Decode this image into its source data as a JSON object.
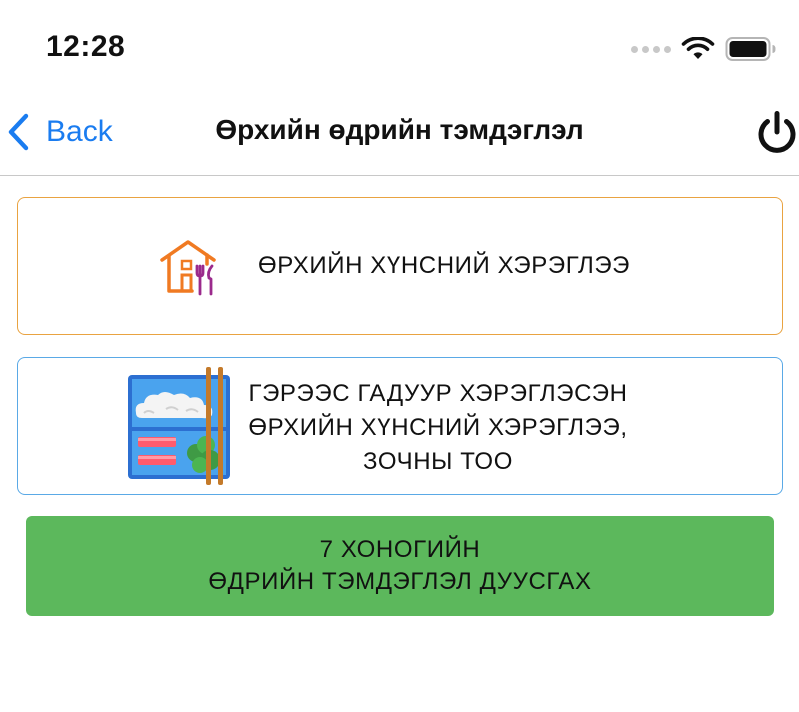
{
  "status_bar": {
    "time": "12:28"
  },
  "nav": {
    "back_label": "Back",
    "title": "Өрхийн өдрийн тэмдэглэл"
  },
  "cards": [
    {
      "label": "ӨРХИЙН ХҮНСНИЙ ХЭРЭГЛЭЭ",
      "border_color": "#e9a341",
      "icon": "house-food-icon"
    },
    {
      "lines": [
        "ГЭРЭЭС ГАДУУР ХЭРЭГЛЭСЭН",
        "ӨРХИЙН ХҮНСНИЙ ХЭРЭГЛЭЭ,",
        "ЗОЧНЫ ТОО"
      ],
      "border_color": "#5aa9e6",
      "icon": "bento-chopsticks-icon"
    }
  ],
  "finish_button": {
    "line1": "7 ХОНОГИЙН",
    "line2": "ӨДРИЙН ТЭМДЭГЛЭЛ ДУУСГАХ",
    "color": "#5cb85c"
  }
}
